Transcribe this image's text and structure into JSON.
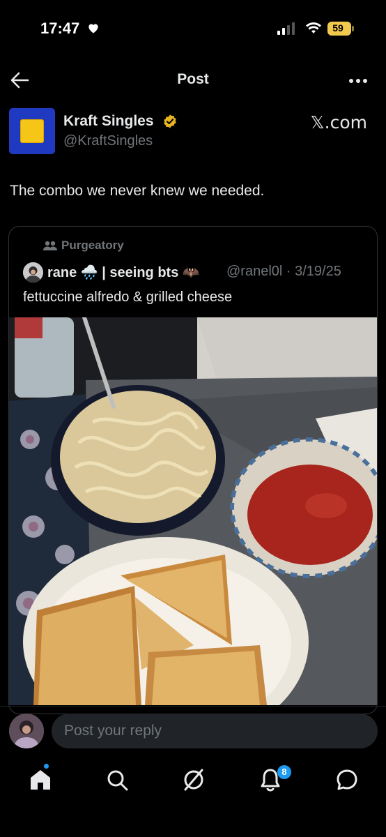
{
  "status_bar": {
    "time": "17:47",
    "battery": "59"
  },
  "header": {
    "title": "Post"
  },
  "author": {
    "name": "Kraft Singles",
    "handle": "@KraftSingles"
  },
  "watermark": "𝕏.com",
  "post": {
    "text": "The combo we never knew we needed."
  },
  "quote": {
    "community": "Purgeatory",
    "name": "rane 🌧️ | seeing bts 🦇",
    "handle": "@ranel0l · 3/19/25",
    "text": "fettuccine alfredo & grilled cheese"
  },
  "reply": {
    "placeholder": "Post your reply"
  },
  "nav": {
    "items": [
      "home-icon",
      "search-icon",
      "grok-icon",
      "notifications-icon",
      "messages-icon"
    ],
    "notification_count": "8"
  },
  "colors": {
    "accent": "#1d9bf0",
    "verified": "#e8b422",
    "muted": "#71767b",
    "brand_blue": "#1f3ac0",
    "brand_yellow": "#f5c518"
  }
}
